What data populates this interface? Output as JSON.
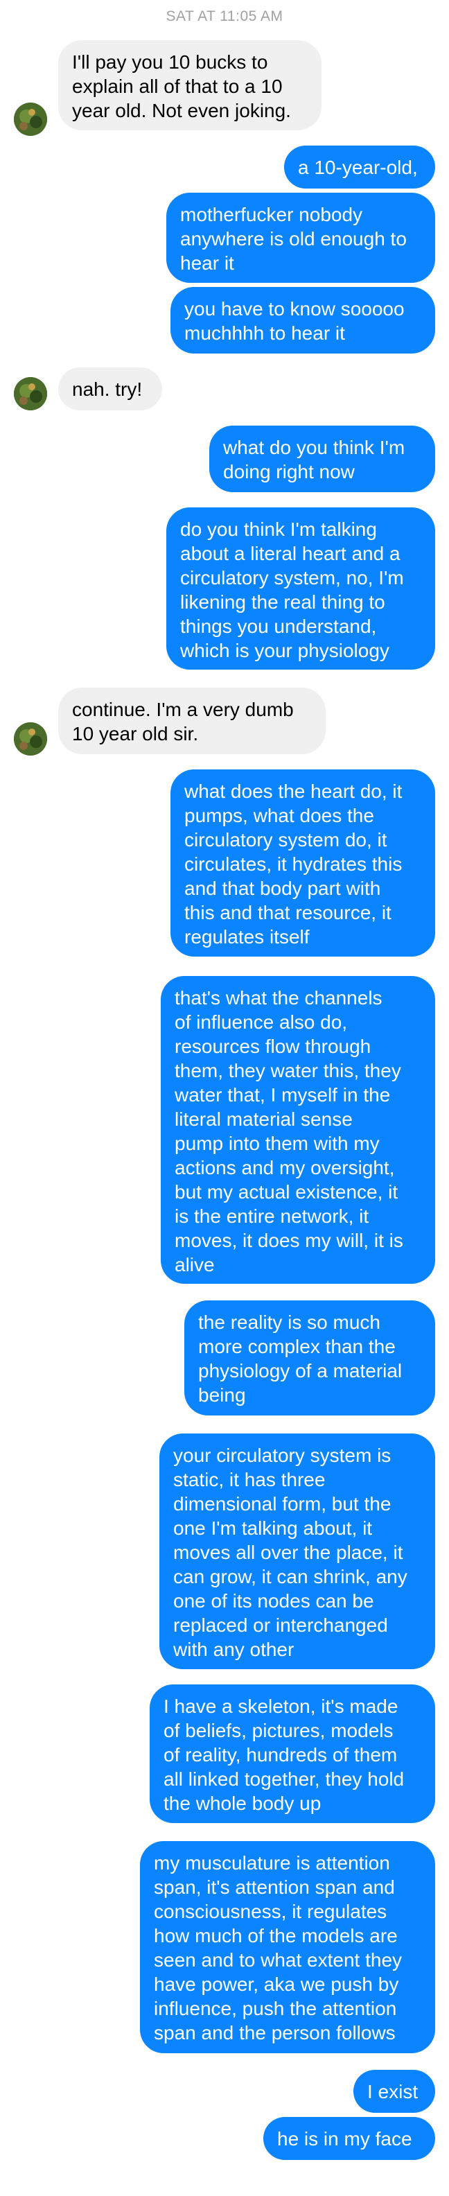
{
  "thread": {
    "timestamp": "SAT AT 11:05 AM",
    "accent_color": "#0a84ff",
    "incoming_color": "#f0f0f0",
    "messages": [
      {
        "side": "in",
        "text": "I'll pay you 10 bucks to\nexplain all of that to a 10\nyear old. Not even joking."
      },
      {
        "side": "out",
        "text": "a 10-year-old,"
      },
      {
        "side": "out",
        "text": "motherfucker nobody\nanywhere is old enough to\nhear it"
      },
      {
        "side": "out",
        "text": "you have to know sooooo\nmuchhhh to hear it"
      },
      {
        "side": "in",
        "text": "nah. try!"
      },
      {
        "side": "out",
        "text": "what do you think I'm\ndoing right now"
      },
      {
        "side": "out",
        "text": "do you think I'm talking\nabout a literal heart and a\ncirculatory system, no, I'm\nlikening the real thing to\nthings you understand,\nwhich is your physiology"
      },
      {
        "side": "in",
        "text": "continue. I'm a very dumb\n10 year old sir."
      },
      {
        "side": "out",
        "text": "what does the heart do, it\npumps, what does the\ncirculatory system do, it\ncirculates, it hydrates this\nand that body part with\nthis and that resource, it\nregulates itself"
      },
      {
        "side": "out",
        "text": "that's what the channels\nof influence also do,\nresources flow through\nthem, they water this, they\nwater that, I myself in the\nliteral material sense\npump into them with my\nactions and my oversight,\nbut my actual existence, it\nis the entire network, it\nmoves, it does my will, it is\nalive"
      },
      {
        "side": "out",
        "text": "the reality is so much\nmore complex than the\nphysiology of a material\nbeing"
      },
      {
        "side": "out",
        "text": "your circulatory system is\nstatic, it has three\ndimensional form, but the\none I'm talking about, it\nmoves all over the place, it\ncan grow, it can shrink, any\none of its nodes can be\nreplaced or interchanged\nwith any other"
      },
      {
        "side": "out",
        "text": "I have a skeleton, it's made\nof beliefs, pictures, models\nof reality, hundreds of them\nall linked together, they hold\nthe whole body up"
      },
      {
        "side": "out",
        "text": "my musculature is attention\nspan, it's attention span and\nconsciousness, it regulates\nhow much of the models are\nseen and to what extent they\nhave power, aka we push by\ninfluence, push the attention\nspan and the person follows"
      },
      {
        "side": "out",
        "text": "I exist"
      },
      {
        "side": "out",
        "text": "he is in my face"
      }
    ]
  },
  "icons": {
    "avatar": "avatar-icon"
  }
}
